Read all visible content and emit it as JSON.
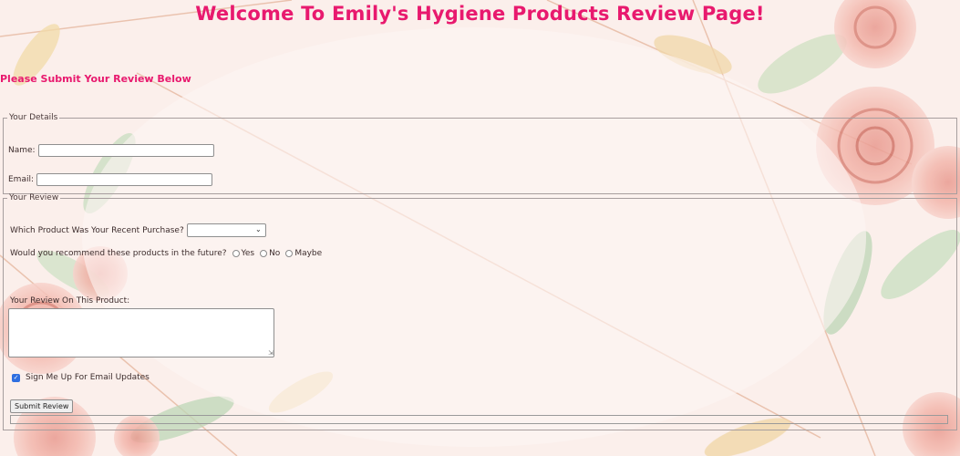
{
  "page": {
    "title": "Welcome To Emily's Hygiene Products Review Page!",
    "subtitle": "Please Submit Your Review Below"
  },
  "details": {
    "legend": "Your Details",
    "name_label": "Name:",
    "name_value": "",
    "email_label": "Email:",
    "email_value": ""
  },
  "review": {
    "legend": "Your Review",
    "product_label": "Which Product Was Your Recent Purchase?",
    "product_selected": "",
    "recommend_label": "Would you recommend these products in the future?",
    "recommend_options": [
      "Yes",
      "No",
      "Maybe"
    ],
    "review_label": "Your Review On This Product:",
    "review_text": "",
    "signup_label": "Sign Me Up For Email Updates",
    "signup_checked": true,
    "submit_label": "Submit Review"
  },
  "colors": {
    "accent": "#e8196e",
    "background": "#fbeeea"
  }
}
